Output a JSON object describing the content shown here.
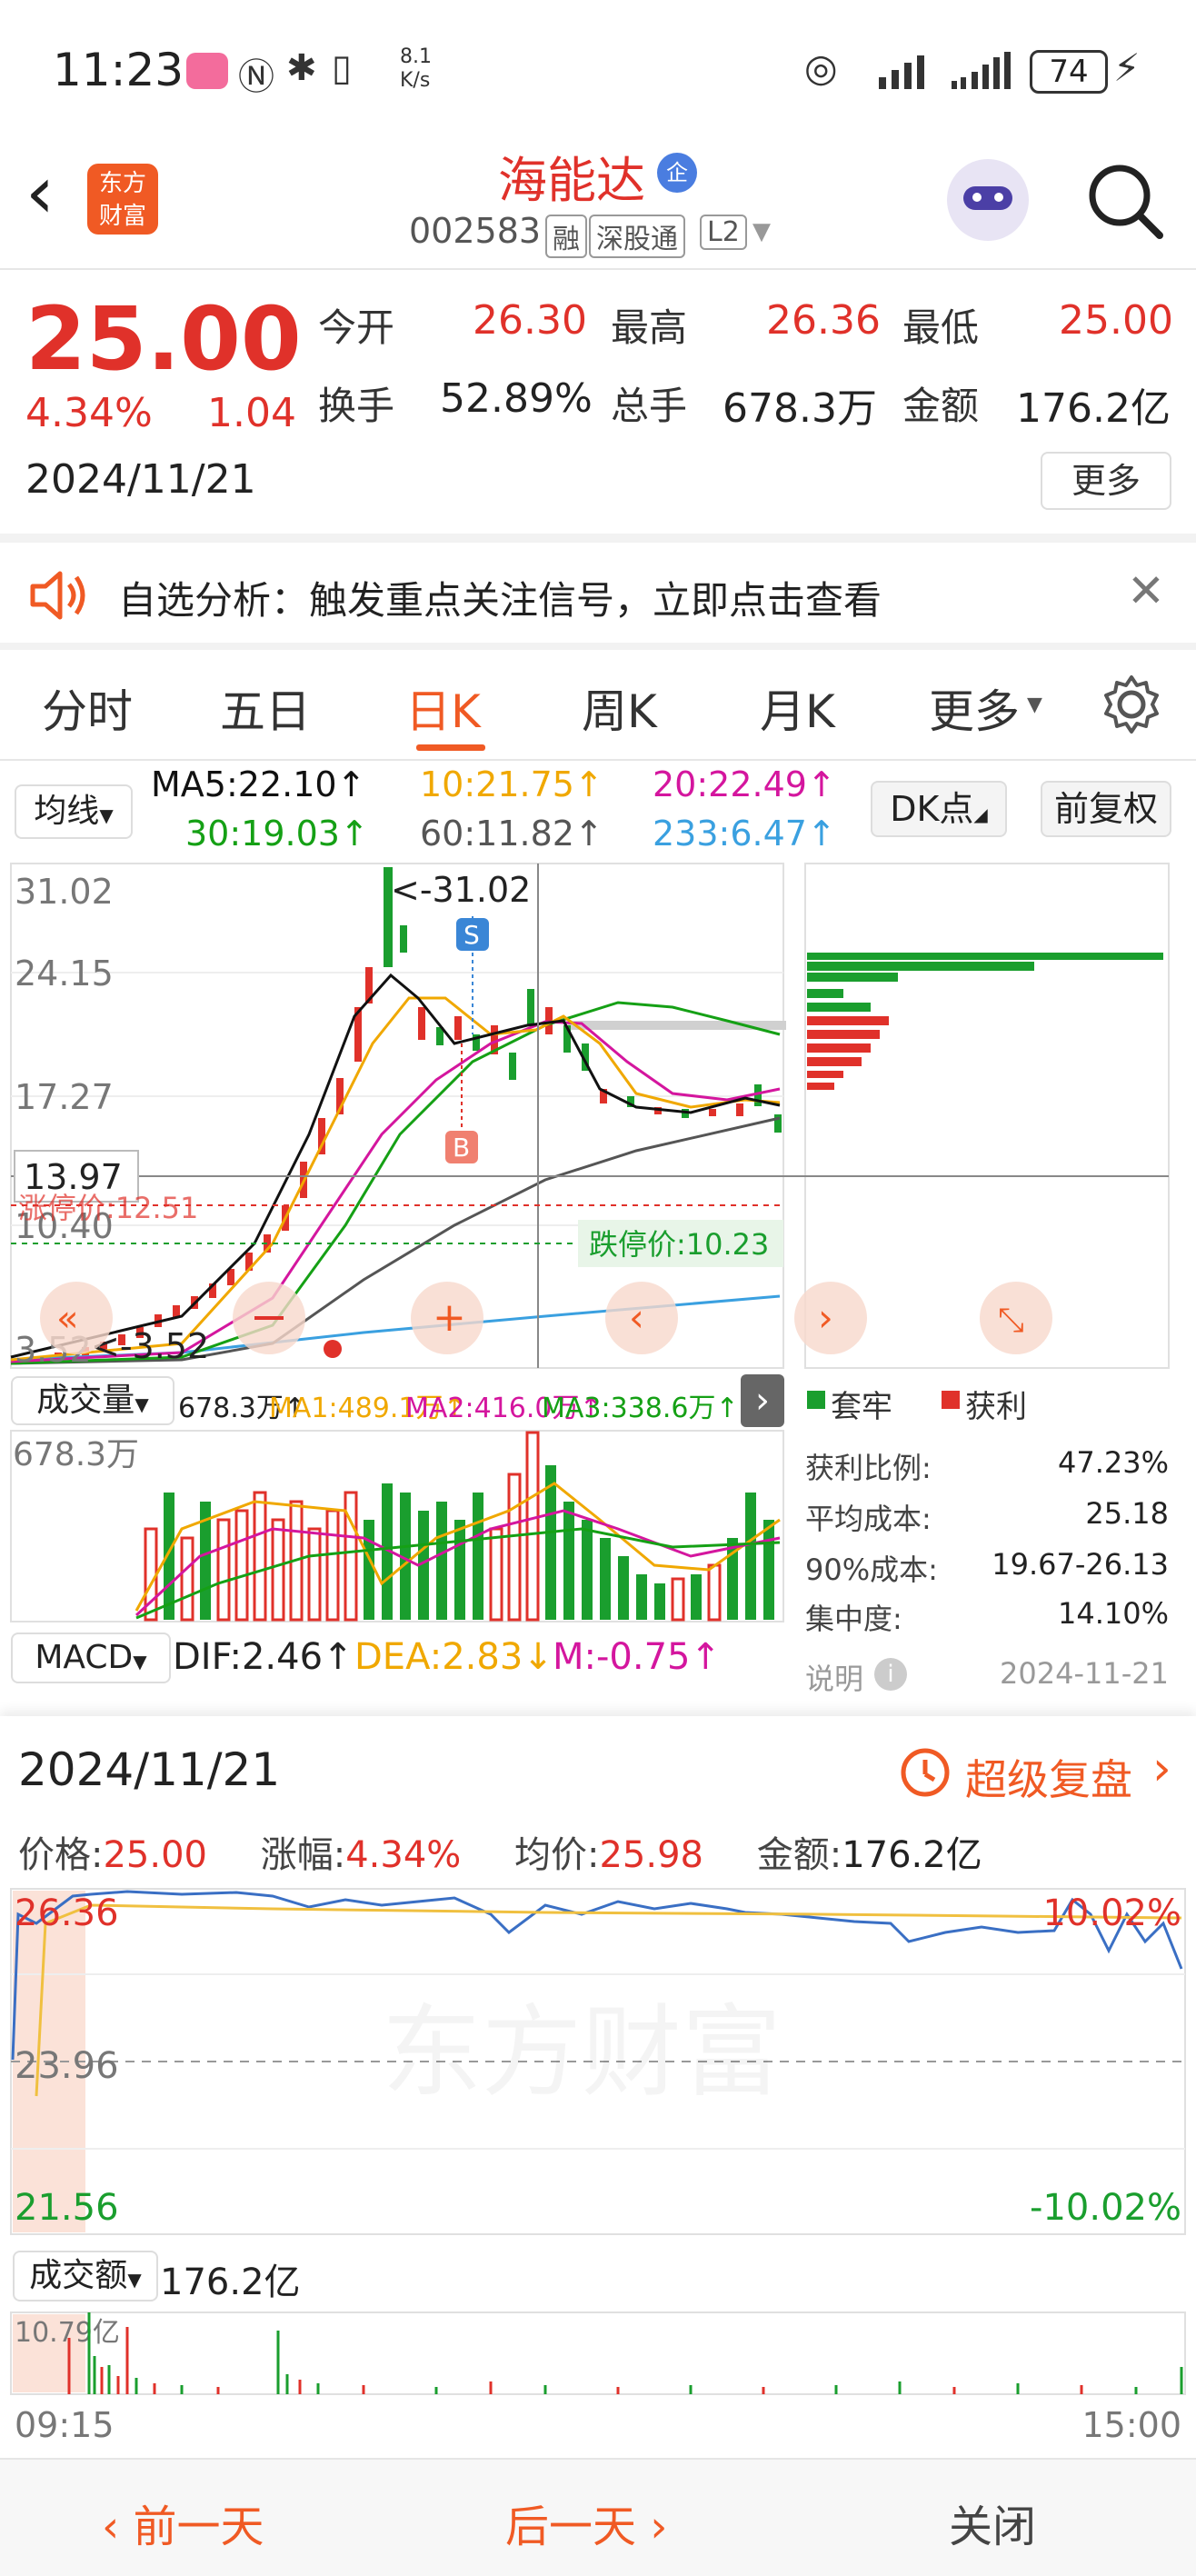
{
  "status": {
    "time": "11:23",
    "net_speed": "8.1",
    "net_unit": "K/s",
    "battery": "74"
  },
  "header": {
    "logo_line1": "东方",
    "logo_line2": "财富",
    "name": "海能达",
    "badge": "企",
    "code": "002583",
    "tags": [
      "融",
      "深股通",
      "L2"
    ]
  },
  "quote": {
    "price": "25.00",
    "change_pct": "4.34%",
    "change": "1.04",
    "date": "2024/11/21",
    "open_label": "今开",
    "open": "26.30",
    "high_label": "最高",
    "high": "26.36",
    "low_label": "最低",
    "low": "25.00",
    "turnover_label": "换手",
    "turnover": "52.89%",
    "volume_label": "总手",
    "volume": "678.3万",
    "amount_label": "金额",
    "amount": "176.2亿",
    "more": "更多"
  },
  "alert": {
    "text": "自选分析：触发重点关注信号，立即点击查看"
  },
  "tabs": [
    "分时",
    "五日",
    "日K",
    "周K",
    "月K",
    "更多"
  ],
  "active_tab": "日K",
  "ma_bar": {
    "selector": "均线",
    "ma5": "MA5:22.10↑",
    "ma10": "10:21.75↑",
    "ma20": "20:22.49↑",
    "ma30": "30:19.03↑",
    "ma60": "60:11.82↑",
    "ma233": "233:6.47↑",
    "dk": "DK点",
    "adjust": "前复权",
    "colors": {
      "ma5": "#111111",
      "ma10": "#f0a800",
      "ma20": "#d4169e",
      "ma30": "#15a015",
      "ma60": "#555555",
      "ma233": "#3aa0e0"
    }
  },
  "kline": {
    "y_labels": [
      "31.02",
      "24.15",
      "17.27",
      "10.40",
      "3.52"
    ],
    "high_marker": "<-31.02",
    "low_marker": "<-3.52",
    "crosshair_value": "13.97",
    "limit_up": "涨停价:12.51",
    "limit_down": "跌停价:10.23",
    "sell_mark": "S",
    "buy_mark": "B"
  },
  "chips": {
    "legend_trapped": "套牢",
    "legend_profit": "获利",
    "rows": [
      {
        "label": "获利比例:",
        "value": "47.23%"
      },
      {
        "label": "平均成本:",
        "value": "25.18"
      },
      {
        "label": "90%成本:",
        "value": "19.67-26.13"
      },
      {
        "label": "集中度:",
        "value": "14.10%"
      }
    ],
    "note": "说明",
    "date": "2024-11-21"
  },
  "volume": {
    "selector": "成交量",
    "value": "678.3万↑",
    "ma1": "MA1:489.1万↑",
    "ma2": "MA2:416.0万↑",
    "ma3": "MA3:338.6万↑",
    "y_label": "678.3万"
  },
  "macd": {
    "selector": "MACD",
    "dif": "DIF:2.46↑",
    "dea": "DEA:2.83↓",
    "m": "M:-0.75↑"
  },
  "detail": {
    "date": "2024/11/21",
    "replay": "超级复盘",
    "price_label": "价格:",
    "price": "25.00",
    "pct_label": "涨幅:",
    "pct": "4.34%",
    "avg_label": "均价:",
    "avg": "25.98",
    "amount_label": "金额:",
    "amount": "176.2亿",
    "y_top": "26.36",
    "y_mid": "23.96",
    "y_bot": "21.56",
    "pct_top": "10.02%",
    "pct_bot": "-10.02%",
    "amount_selector": "成交额",
    "amount_total": "176.2亿",
    "amount_ymax": "10.79亿",
    "t_start": "09:15",
    "t_end": "15:00",
    "watermark": "东方财富"
  },
  "bottom": {
    "prev": "前一天",
    "next": "后一天",
    "close": "关闭"
  }
}
